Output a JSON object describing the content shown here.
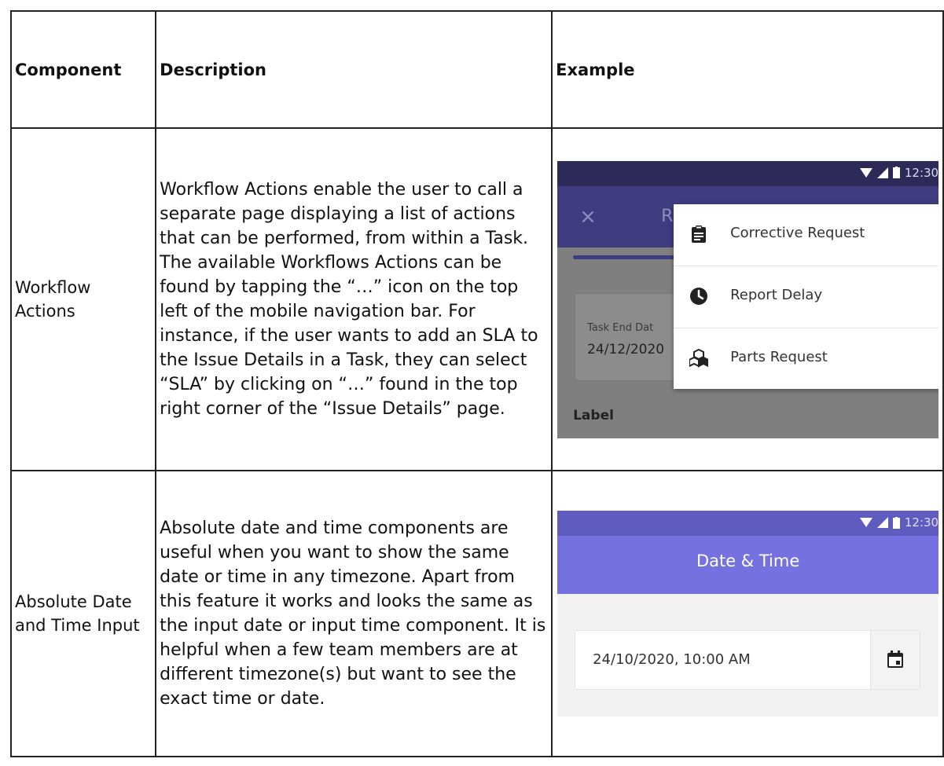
{
  "table": {
    "headers": [
      "Component",
      "Description",
      "Example"
    ],
    "rows": [
      {
        "component": "Workflow Actions",
        "description": "Workflow Actions enable the user to call a separate page displaying a list of actions that can be performed, from within a Task. The available Workflows Actions can be found by tapping the “…” icon on the top left of the mobile navigation bar. For instance, if the user wants to add an SLA to the Issue Details in a Task, they can select “SLA” by clicking on “…” found in the top right corner of the “Issue Details” page."
      },
      {
        "component": "Absolute Date and Time Input",
        "description": "Absolute date and time components are useful when you want to show the same date or time in any timezone. Apart from this feature it works and looks the same as the input date or input time component. It is helpful when a few team members are at different timezone(s) but want to see the exact time or date."
      }
    ]
  },
  "example1": {
    "status_time": "12:30",
    "close_glyph": "×",
    "title_fragment": "R",
    "card_label": "Task End Dat",
    "card_value": "24/12/2020",
    "field_label": "Label",
    "menu": [
      {
        "icon": "clipboard-icon",
        "label": "Corrective Request"
      },
      {
        "icon": "clock-icon",
        "label": "Report Delay"
      },
      {
        "icon": "boxes-icon",
        "label": "Parts Request"
      }
    ],
    "colors": {
      "status_bar": "#2d2958",
      "app_bar": "#3f3c80",
      "overlay": "#7f7f7f"
    }
  },
  "example2": {
    "status_time": "12:30",
    "title": "Date & Time",
    "field_value": "24/10/2020, 10:00 AM",
    "button_icon": "calendar-icon",
    "colors": {
      "status_bar": "#5f5bbf",
      "app_bar": "#7571e0"
    }
  }
}
